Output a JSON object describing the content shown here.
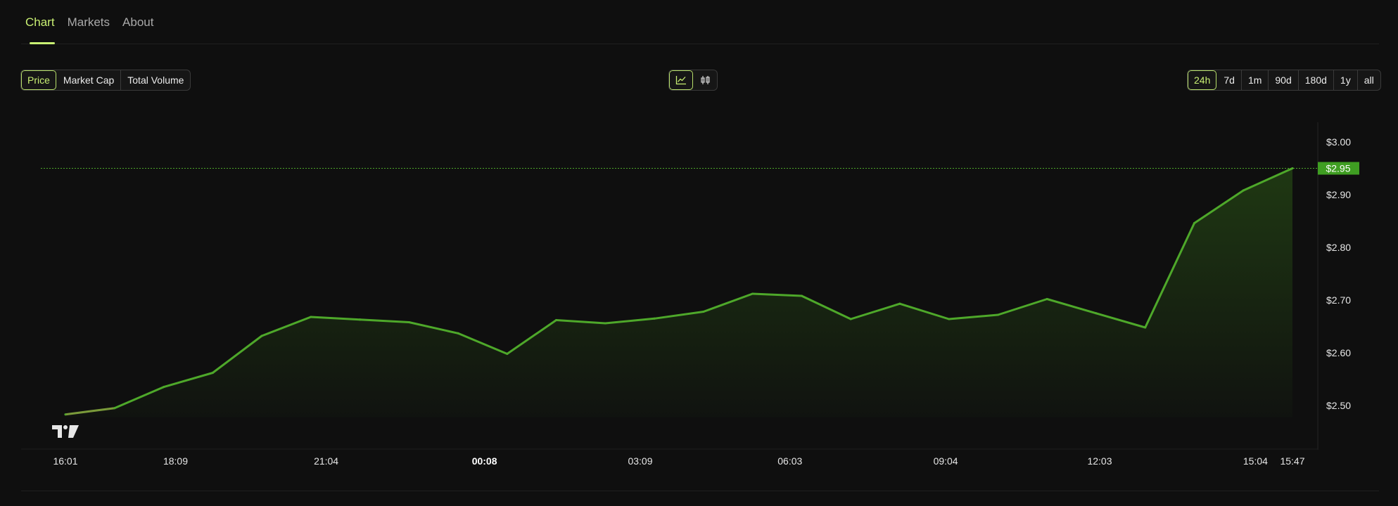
{
  "tabs": [
    {
      "label": "Chart",
      "active": true
    },
    {
      "label": "Markets",
      "active": false
    },
    {
      "label": "About",
      "active": false
    }
  ],
  "metrics": [
    {
      "label": "Price",
      "active": true
    },
    {
      "label": "Market Cap",
      "active": false
    },
    {
      "label": "Total Volume",
      "active": false
    }
  ],
  "view_toggle": [
    {
      "icon": "line-chart-icon",
      "active": true
    },
    {
      "icon": "candlestick-icon",
      "active": false
    }
  ],
  "ranges": [
    {
      "label": "24h",
      "active": true
    },
    {
      "label": "7d",
      "active": false
    },
    {
      "label": "1m",
      "active": false
    },
    {
      "label": "90d",
      "active": false
    },
    {
      "label": "180d",
      "active": false
    },
    {
      "label": "1y",
      "active": false
    },
    {
      "label": "all",
      "active": false
    }
  ],
  "colors": {
    "accent": "#c9f073",
    "line": "#4ea82a",
    "price_tag": "#3f9e22",
    "background": "#0f0f0f"
  },
  "watermark_icon": "tradingview-logo-icon",
  "chart_data": {
    "type": "area",
    "title": "",
    "xlabel": "",
    "ylabel": "",
    "ylim": [
      2.45,
      3.05
    ],
    "x_ticks": [
      {
        "label": "16:01",
        "bold": false,
        "t": 0
      },
      {
        "label": "18:09",
        "bold": false,
        "t": 128
      },
      {
        "label": "21:04",
        "bold": false,
        "t": 303
      },
      {
        "label": "00:08",
        "bold": true,
        "t": 487
      },
      {
        "label": "03:09",
        "bold": false,
        "t": 668
      },
      {
        "label": "06:03",
        "bold": false,
        "t": 842
      },
      {
        "label": "09:04",
        "bold": false,
        "t": 1023
      },
      {
        "label": "12:03",
        "bold": false,
        "t": 1202
      },
      {
        "label": "15:04",
        "bold": false,
        "t": 1383
      },
      {
        "label": "15:47",
        "bold": false,
        "t": 1426
      }
    ],
    "y_ticks": [
      {
        "label": "$2.50",
        "value": 2.5
      },
      {
        "label": "$2.60",
        "value": 2.6
      },
      {
        "label": "$2.70",
        "value": 2.7
      },
      {
        "label": "$2.80",
        "value": 2.8
      },
      {
        "label": "$2.90",
        "value": 2.9
      },
      {
        "label": "$3.00",
        "value": 3.0
      }
    ],
    "current_price": {
      "label": "$2.95",
      "value": 2.95
    },
    "series": [
      {
        "points": [
          {
            "t": 0,
            "v": 2.483
          },
          {
            "t": 52,
            "v": 2.495
          },
          {
            "t": 104,
            "v": 2.535
          },
          {
            "t": 156,
            "v": 2.562
          },
          {
            "t": 208,
            "v": 2.632
          },
          {
            "t": 260,
            "v": 2.668
          },
          {
            "t": 312,
            "v": 2.663
          },
          {
            "t": 364,
            "v": 2.658
          },
          {
            "t": 416,
            "v": 2.637
          },
          {
            "t": 468,
            "v": 2.598
          },
          {
            "t": 520,
            "v": 2.662
          },
          {
            "t": 572,
            "v": 2.656
          },
          {
            "t": 624,
            "v": 2.665
          },
          {
            "t": 676,
            "v": 2.678
          },
          {
            "t": 728,
            "v": 2.712
          },
          {
            "t": 780,
            "v": 2.708
          },
          {
            "t": 832,
            "v": 2.664
          },
          {
            "t": 884,
            "v": 2.693
          },
          {
            "t": 936,
            "v": 2.664
          },
          {
            "t": 988,
            "v": 2.672
          },
          {
            "t": 1040,
            "v": 2.702
          },
          {
            "t": 1092,
            "v": 2.675
          },
          {
            "t": 1144,
            "v": 2.648
          },
          {
            "t": 1196,
            "v": 2.846
          },
          {
            "t": 1248,
            "v": 2.908
          },
          {
            "t": 1300,
            "v": 2.95
          }
        ]
      }
    ]
  }
}
